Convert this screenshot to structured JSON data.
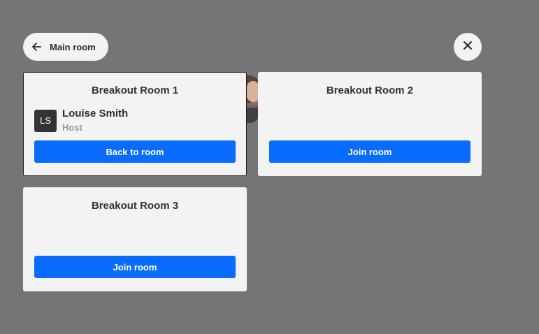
{
  "header": {
    "back_label": "Main room",
    "back_icon": "arrow-left-icon",
    "close_icon": "close-icon"
  },
  "rooms": [
    {
      "title": "Breakout Room 1",
      "active": true,
      "participants": [
        {
          "initials": "LS",
          "name": "Louise Smith",
          "role": "Host"
        }
      ],
      "action_label": "Back to room"
    },
    {
      "title": "Breakout Room 2",
      "active": false,
      "participants": [],
      "action_label": "Join room"
    },
    {
      "title": "Breakout Room 3",
      "active": false,
      "participants": [],
      "action_label": "Join room"
    }
  ],
  "colors": {
    "overlay": "#757575",
    "card": "#f3f3f3",
    "accent": "#0a6cff",
    "avatar": "#333333"
  }
}
